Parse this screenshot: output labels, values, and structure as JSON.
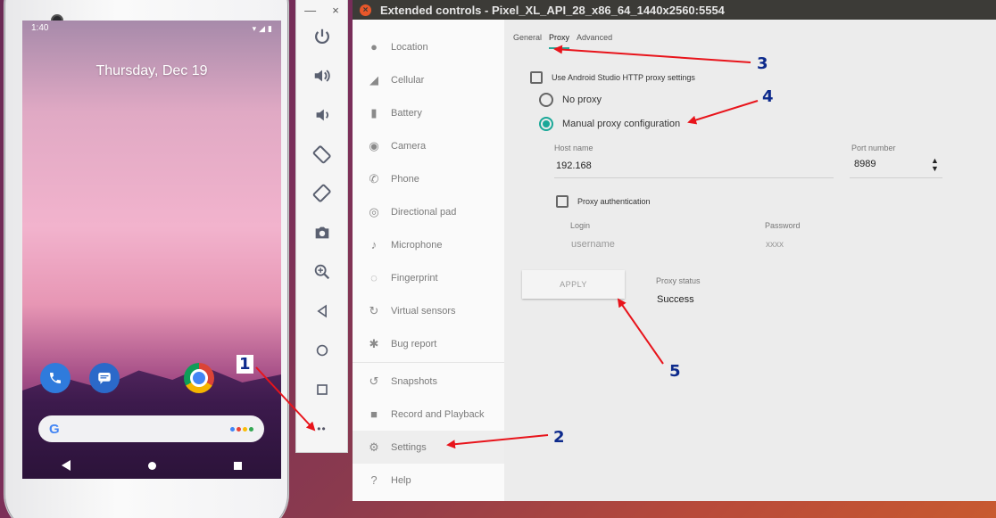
{
  "phone": {
    "status_time": "1:40",
    "date": "Thursday, Dec 19",
    "search_logo": "G"
  },
  "window": {
    "title": "Extended controls - Pixel_XL_API_28_x86_64_1440x2560:5554",
    "close_symbol": "×"
  },
  "toolbar": {
    "minimize_symbol": "—",
    "close_symbol": "×",
    "more_symbol": "••"
  },
  "sidebar": {
    "items": [
      {
        "label": "Location",
        "icon": "location-pin-icon",
        "glyph": "●"
      },
      {
        "label": "Cellular",
        "icon": "signal-icon",
        "glyph": "◢"
      },
      {
        "label": "Battery",
        "icon": "battery-icon",
        "glyph": "▮"
      },
      {
        "label": "Camera",
        "icon": "camera-icon",
        "glyph": "◉"
      },
      {
        "label": "Phone",
        "icon": "phone-icon",
        "glyph": "✆"
      },
      {
        "label": "Directional pad",
        "icon": "dpad-icon",
        "glyph": "◎"
      },
      {
        "label": "Microphone",
        "icon": "microphone-icon",
        "glyph": "♪"
      },
      {
        "label": "Fingerprint",
        "icon": "fingerprint-icon",
        "glyph": "◌"
      },
      {
        "label": "Virtual sensors",
        "icon": "sensors-icon",
        "glyph": "↻"
      },
      {
        "label": "Bug report",
        "icon": "bug-icon",
        "glyph": "✱"
      },
      {
        "label": "Snapshots",
        "icon": "history-icon",
        "glyph": "↺"
      },
      {
        "label": "Record and Playback",
        "icon": "video-icon",
        "glyph": "■"
      },
      {
        "label": "Settings",
        "icon": "gear-icon",
        "glyph": "⚙"
      },
      {
        "label": "Help",
        "icon": "help-icon",
        "glyph": "?"
      }
    ]
  },
  "tabs": [
    "General",
    "Proxy",
    "Advanced"
  ],
  "proxy": {
    "use_studio_label": "Use Android Studio HTTP proxy settings",
    "no_proxy_label": "No proxy",
    "manual_label": "Manual proxy configuration",
    "host_label": "Host name",
    "host_value": "192.168",
    "port_label": "Port number",
    "port_value": "8989",
    "auth_label": "Proxy authentication",
    "login_label": "Login",
    "login_placeholder": "username",
    "password_label": "Password",
    "password_placeholder": "xxxx",
    "apply_label": "APPLY",
    "status_label": "Proxy status",
    "status_value": "Success"
  },
  "annotations": [
    "1",
    "2",
    "3",
    "4",
    "5"
  ],
  "colors": {
    "accent": "#1aa898",
    "arrow": "#e8141b",
    "annotation": "#0d2a8c",
    "titlebar": "#3c3b37"
  }
}
